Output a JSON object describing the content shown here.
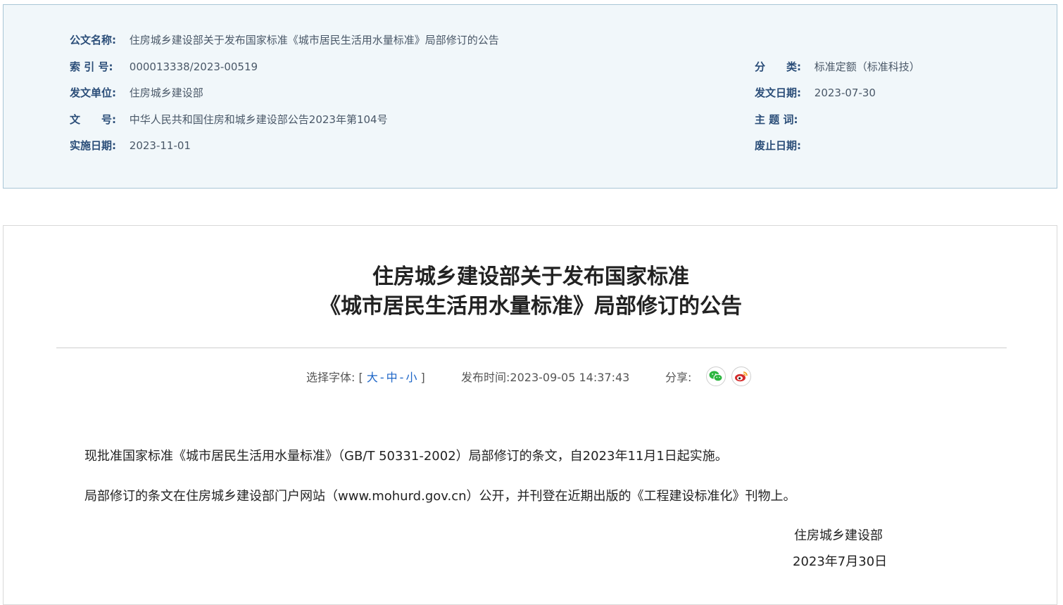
{
  "meta": {
    "doc_name_label": "公文名称:",
    "doc_name_value": "住房城乡建设部关于发布国家标准《城市居民生活用水量标准》局部修订的公告",
    "index_label": "索 引 号:",
    "index_value": "000013338/2023-00519",
    "category_label": "分　　类:",
    "category_value": "标准定额（标准科技）",
    "issuer_label": "发文单位:",
    "issuer_value": "住房城乡建设部",
    "issue_date_label": "发文日期:",
    "issue_date_value": "2023-07-30",
    "doc_no_label": "文　　号:",
    "doc_no_value": "中华人民共和国住房和城乡建设部公告2023年第104号",
    "subject_label": "主 题 词:",
    "subject_value": "",
    "effective_label": "实施日期:",
    "effective_value": "2023-11-01",
    "abolish_label": "废止日期:",
    "abolish_value": ""
  },
  "article": {
    "title_line1": "住房城乡建设部关于发布国家标准",
    "title_line2": "《城市居民生活用水量标准》局部修订的公告",
    "toolbar": {
      "font_label": "选择字体:",
      "bracket_open": "[",
      "size_large": "大",
      "size_medium": "中",
      "size_small": "小",
      "sep": "-",
      "bracket_close": "]",
      "publish_label": "发布时间:",
      "publish_value": "2023-09-05 14:37:43",
      "share_label": "分享:"
    },
    "paragraph1": "现批准国家标准《城市居民生活用水量标准》（GB/T 50331-2002）局部修订的条文，自2023年11月1日起实施。",
    "paragraph2": "局部修订的条文在住房城乡建设部门户网站（www.mohurd.gov.cn）公开，并刊登在近期出版的《工程建设标准化》刊物上。",
    "signature_org": "住房城乡建设部",
    "signature_date": "2023年7月30日"
  },
  "icons": {
    "wechat": "wechat-icon",
    "weibo": "weibo-icon"
  },
  "colors": {
    "wechat": "#2db640",
    "weibo": "#d52b2b",
    "label": "#2a4d78",
    "link": "#1e66c7"
  }
}
